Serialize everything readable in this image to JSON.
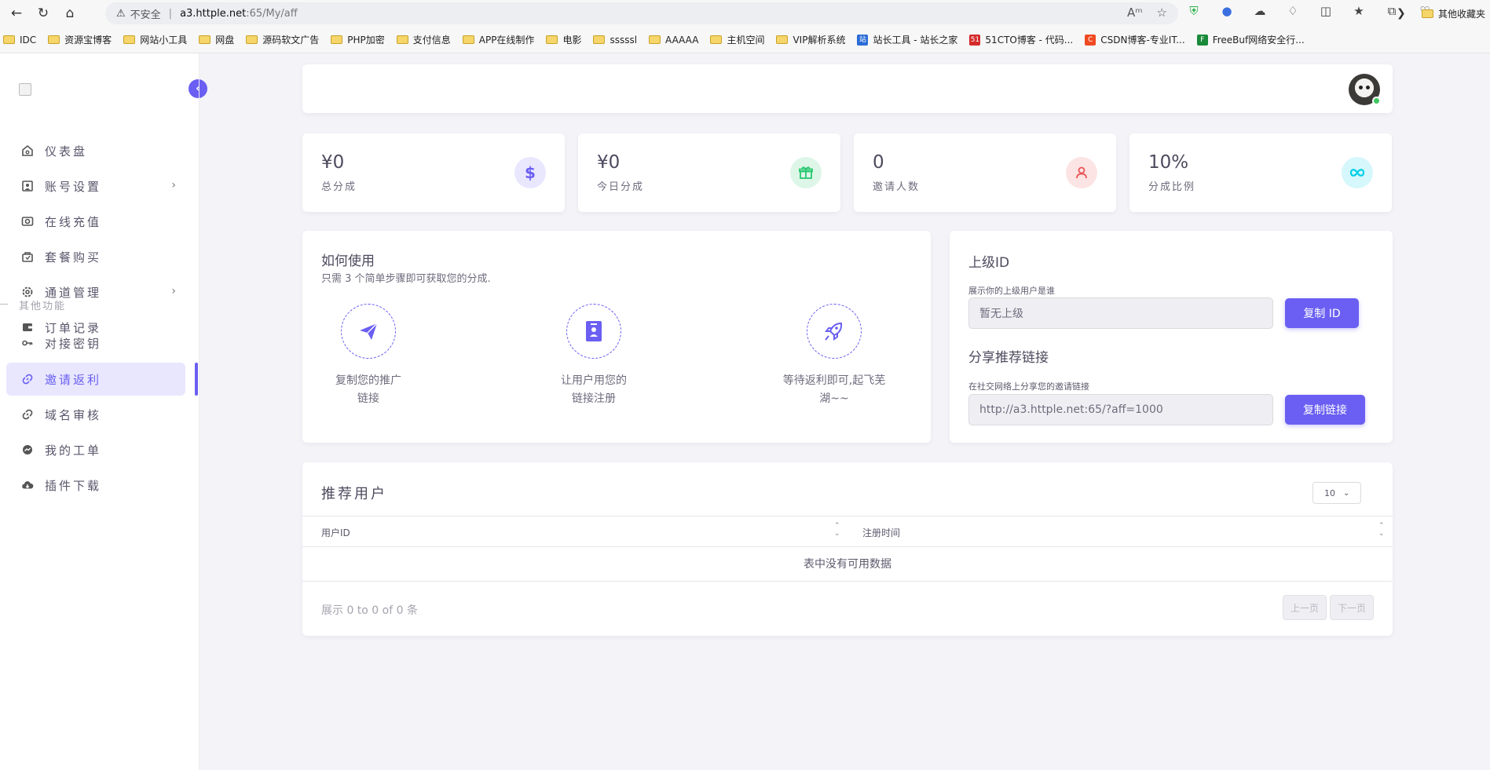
{
  "browser": {
    "insecure_label": "不安全",
    "url_host": "a3.httple.net",
    "url_path": ":65/My/aff",
    "bookmarks": [
      "IDC",
      "资源宝博客",
      "网站小工具",
      "网盘",
      "源码软文广告",
      "PHP加密",
      "支付信息",
      "APP在线制作",
      "电影",
      "sssssl",
      "AAAAA",
      "主机空间",
      "VIP解析系统",
      "站长工具 - 站长之家",
      "51CTO博客 - 代码...",
      "CSDN博客-专业IT...",
      "FreeBuf网络安全行..."
    ],
    "other_bookmarks": "其他收藏夹"
  },
  "sidebar": {
    "items": [
      {
        "label": "仪表盘",
        "icon": "home-icon"
      },
      {
        "label": "账号设置",
        "icon": "user-card-icon"
      },
      {
        "label": "在线充值",
        "icon": "camera-icon"
      },
      {
        "label": "套餐购买",
        "icon": "bag-icon"
      },
      {
        "label": "通道管理",
        "icon": "gear-icon"
      },
      {
        "label": "订单记录",
        "icon": "wallet-icon"
      }
    ],
    "section_title": "其他功能",
    "items2": [
      {
        "label": "对接密钥",
        "icon": "key-icon"
      },
      {
        "label": "邀请返利",
        "icon": "link-icon"
      },
      {
        "label": "域名审核",
        "icon": "link-icon"
      },
      {
        "label": "我的工单",
        "icon": "messenger-icon"
      },
      {
        "label": "插件下载",
        "icon": "cloud-download-icon"
      }
    ]
  },
  "stats": [
    {
      "value": "¥0",
      "label": "总分成",
      "icon": "dollar-icon",
      "color": "#6a5ff2",
      "bg": "#e9e7fe"
    },
    {
      "value": "¥0",
      "label": "今日分成",
      "icon": "gift-icon",
      "color": "#28c76f",
      "bg": "#ddf6e8"
    },
    {
      "value": "0",
      "label": "邀请人数",
      "icon": "user-icon",
      "color": "#ea5455",
      "bg": "#fce4e4"
    },
    {
      "value": "10%",
      "label": "分成比例",
      "icon": "infinity-icon",
      "color": "#00cfe8",
      "bg": "#d6f7fb"
    }
  ],
  "howto": {
    "title": "如何使用",
    "subtitle": "只需 3 个简单步骤即可获取您的分成.",
    "steps": [
      "复制您的推广链接",
      "让用户用您的链接注册",
      "等待返利即可,起飞芜湖~~"
    ]
  },
  "upline": {
    "title": "上级ID",
    "hint": "展示你的上级用户是谁",
    "value": "暂无上级",
    "copy_id": "复制 ID",
    "share_title": "分享推荐链接",
    "share_hint": "在社交网络上分享您的邀请链接",
    "link": "http://a3.httple.net:65/?aff=1000",
    "copy_link": "复制链接"
  },
  "table": {
    "title": "推荐用户",
    "page_size": "10",
    "col1": "用户ID",
    "col2": "注册时间",
    "empty": "表中没有可用数据",
    "info": "展示 0 to 0 of 0 条",
    "prev": "上一页",
    "next": "下一页"
  }
}
